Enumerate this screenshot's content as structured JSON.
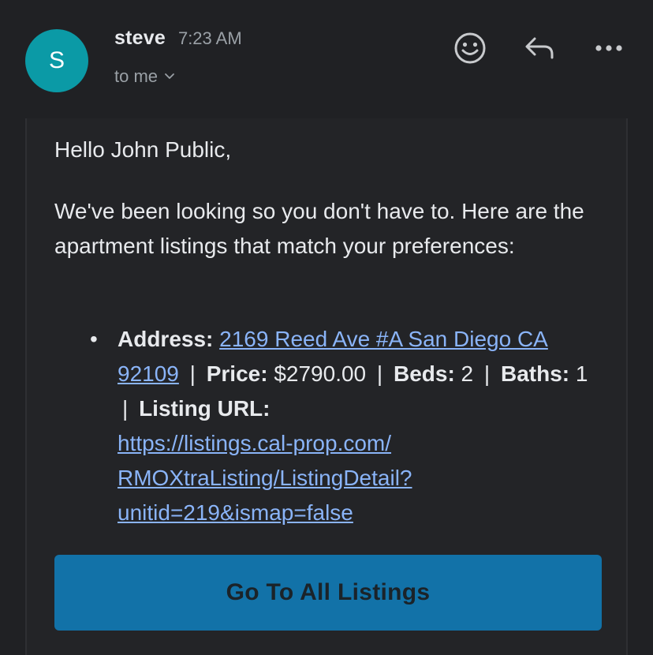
{
  "sender": {
    "initial": "S",
    "name": "steve",
    "time": "7:23 AM",
    "recipient": "to me"
  },
  "header_icons": {
    "emoji": "smiley-face-icon",
    "reply": "reply-arrow-icon",
    "more": "more-options-icon"
  },
  "email": {
    "greeting": "Hello John Public,",
    "intro": "We've been looking so you don't have to. Here are the apartment listings that match your preferences:",
    "listing": {
      "address_label": "Address:",
      "address_value": "2169 Reed Ave #A San Diego CA 92109",
      "separator": "|",
      "price_label": "Price:",
      "price_value": "$2790.00",
      "beds_label": "Beds:",
      "beds_value": "2",
      "baths_label": "Baths:",
      "baths_value": "1",
      "url_label": "Listing URL:",
      "url_value": "https://listings.cal-prop.com/RMOXtraListing/ListingDetail?unitid=219&ismap=false"
    },
    "cta_label": "Go To All Listings"
  },
  "colors": {
    "background": "#202124",
    "avatar": "#0b9aa6",
    "link": "#8ab4f8",
    "cta": "#1272a8"
  }
}
